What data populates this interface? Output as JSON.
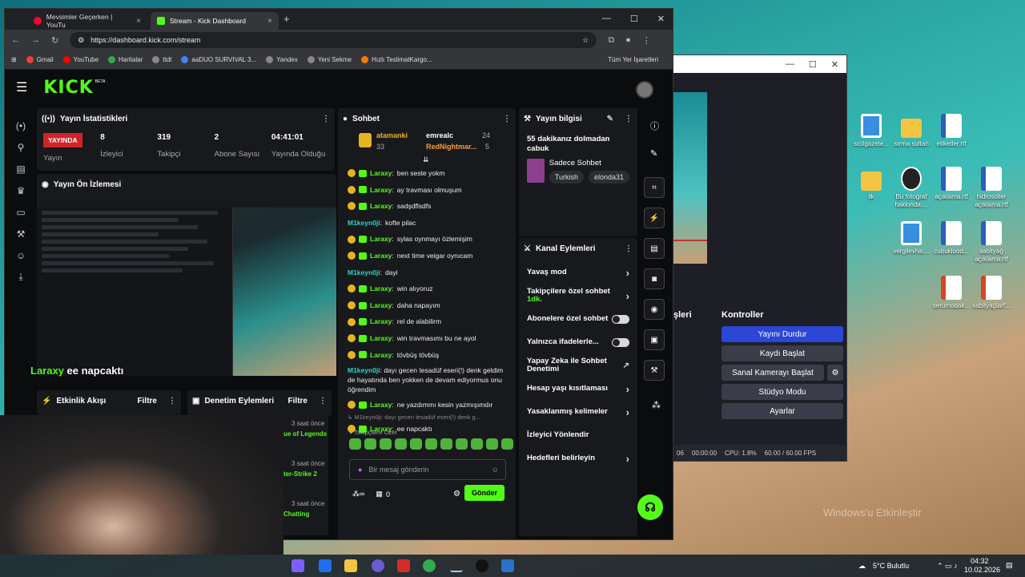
{
  "desktop": {
    "icons": [
      {
        "label": "sicilgazete...",
        "kind": "img"
      },
      {
        "label": "sırma sultan",
        "kind": "folder"
      },
      {
        "label": "etiketler.rtf",
        "kind": "word"
      },
      {
        "label": "ilk",
        "kind": "folder"
      },
      {
        "label": "Bu fotoğraf hakkında ...",
        "kind": "round"
      },
      {
        "label": "açıklama.rtf",
        "kind": "word"
      },
      {
        "label": "hidrosoller açıklama.rtf",
        "kind": "word"
      },
      {
        "label": "vergilevha....",
        "kind": "img"
      },
      {
        "label": "cubukluod...",
        "kind": "word"
      },
      {
        "label": "sabityağ açıklama.rtf",
        "kind": "word"
      },
      {
        "label": "serumodak...",
        "kind": "ppt"
      },
      {
        "label": "sabityağlarf...",
        "kind": "ppt"
      }
    ],
    "watermark": "Windows'u Etkinleştir"
  },
  "taskbar": {
    "weather": "5°C Bulutlu",
    "time": "04:32",
    "date": "10.02.2026"
  },
  "obs": {
    "dock_left_title": "şleri",
    "dock_title": "Kontroller",
    "buttons": [
      "Yayını Durdur",
      "Kaydı Başlat",
      "Sanal Kamerayı Başlat",
      "Stüdyo Modu",
      "Ayarlar"
    ],
    "status": {
      "time": "00:00:00",
      "cpu": "CPU: 1.8%",
      "fps": "60.00 / 60.00 FPS",
      "left": "06"
    }
  },
  "browser": {
    "tabs": [
      {
        "title": "Mevsimler Geçerken | YouTu",
        "color": "#ff0033"
      },
      {
        "title": "Stream - Kick Dashboard",
        "color": "#53fc18"
      }
    ],
    "url": "https://dashboard.kick.com/stream",
    "bookmarks": [
      {
        "label": "Gmail",
        "color": "#ea4335"
      },
      {
        "label": "YouTube",
        "color": "#ff0000"
      },
      {
        "label": "Haritalar",
        "color": "#34a853"
      },
      {
        "label": "ttdt",
        "color": "#888888"
      },
      {
        "label": "aaDUO SURVIVAL 3...",
        "color": "#4285f4"
      },
      {
        "label": "Yandex",
        "color": "#888888"
      },
      {
        "label": "Yeni Sekme",
        "color": "#888888"
      },
      {
        "label": "Hızlı TeslimatKargo...",
        "color": "#f57c00"
      }
    ],
    "all_bookmarks": "Tüm Yer İşaretleri"
  },
  "kick": {
    "logo": "KICK",
    "logo_tag": "BETA",
    "stats_panel": {
      "title": "Yayın İstatistikleri",
      "live": "YAYINDA",
      "stream_label": "Yayın",
      "viewers_value": "8",
      "viewers_label": "İzleyici",
      "followers_value": "319",
      "followers_label": "Takipçi",
      "subs_value": "2",
      "subs_label": "Abone Sayısı",
      "uptime_value": "04:41:01",
      "uptime_label": "Yayında Olduğu"
    },
    "preview_panel": {
      "title": "Yayın Ön İzlemesi",
      "overlay_user": "Laraxy",
      "overlay_text": "ee napcaktı"
    },
    "activity_panel": {
      "title": "Etkinlik Akışı",
      "filter": "Filtre"
    },
    "moderation_panel": {
      "title": "Denetim Eylemleri",
      "filter": "Filtre"
    },
    "feed": [
      {
        "time": "3 saat önce",
        "name": "ue of Legends"
      },
      {
        "time": "3 saat önce",
        "name": "ter-Strike 2"
      },
      {
        "time": "3 saat önce",
        "name": "Chatting"
      },
      {
        "time": "3 saat önce",
        "name": ""
      }
    ],
    "chat": {
      "title": "Sohbet",
      "top": [
        {
          "name": "atamanki",
          "count": "33"
        },
        {
          "name": "emrealc",
          "count": "24"
        },
        {
          "name": "RedNightmar...",
          "count": "5"
        }
      ],
      "messages": [
        {
          "user": "Laraxy",
          "text": "ben seste yokm",
          "badges": true
        },
        {
          "user": "Laraxy",
          "text": "ay travması olmuşum",
          "badges": true
        },
        {
          "user": "Laraxy",
          "text": "sadşdflsdfs",
          "badges": true
        },
        {
          "user": "M1keyn0ji",
          "text": "kofte pilac",
          "badges": false
        },
        {
          "user": "Laraxy",
          "text": "sylas oynmayı özlemişim",
          "badges": true
        },
        {
          "user": "Laraxy",
          "text": "next time veigar oynıcam",
          "badges": true
        },
        {
          "user": "M1keyn0ji",
          "text": "dayi",
          "badges": false
        },
        {
          "user": "Laraxy",
          "text": "win alıyoruz",
          "badges": true
        },
        {
          "user": "Laraxy",
          "text": "daha napayım",
          "badges": true
        },
        {
          "user": "Laraxy",
          "text": "rel de alabilirm",
          "badges": true
        },
        {
          "user": "Laraxy",
          "text": "win travmasımı bu ne ayol",
          "badges": true
        },
        {
          "user": "Laraxy",
          "text": "tövbüş tövbüş",
          "badges": true
        }
      ],
      "long_message": {
        "user": "M1keyn0ji",
        "text": "dayı gecen tesadüf eseri(!) denk geldim de hayatında ben yokken de devam ediyormus onu öğrendim"
      },
      "after": [
        {
          "user": "Laraxy",
          "text": "ne yazdımmı kesin yazmışımdır"
        }
      ],
      "reply_ref": "↳ M1keyn0ji: dayı gecen tesadüf eseri(!) denk g...",
      "last": {
        "user": "Laraxy",
        "text": "ee napcaktı"
      },
      "emote_header": "Takipçilere Özel",
      "placeholder": "Bir mesaj gönderin",
      "points": "0",
      "send": "Gönder"
    },
    "info_panel": {
      "title": "Yayın bilgisi",
      "stream_title": "55 dakikanız dolmadan cabuk",
      "category": "Sadece Sohbet",
      "tags": [
        "Turkish",
        "elonda31"
      ]
    },
    "actions_panel": {
      "title": "Kanal Eylemleri",
      "rows": [
        {
          "label": "Yavaş mod",
          "control": "arrow"
        },
        {
          "label": "Takipçilere özel sohbet",
          "sub": "1dk.",
          "control": "arrow"
        },
        {
          "label": "Abonelere özel sohbet",
          "control": "toggle"
        },
        {
          "label": "Yalnızca ifadelerle...",
          "control": "toggle"
        },
        {
          "label": "Yapay Zeka ile Sohbet Denetimi",
          "control": "ext"
        },
        {
          "label": "Hesap yaşı kısıtlaması",
          "control": "arrow"
        },
        {
          "label": "Yasaklanmış kelimeler",
          "control": "arrow"
        },
        {
          "label": "İzleyici Yönlendir",
          "control": "none"
        },
        {
          "label": "Hedefleri belirleyin",
          "control": "arrow"
        }
      ]
    }
  }
}
